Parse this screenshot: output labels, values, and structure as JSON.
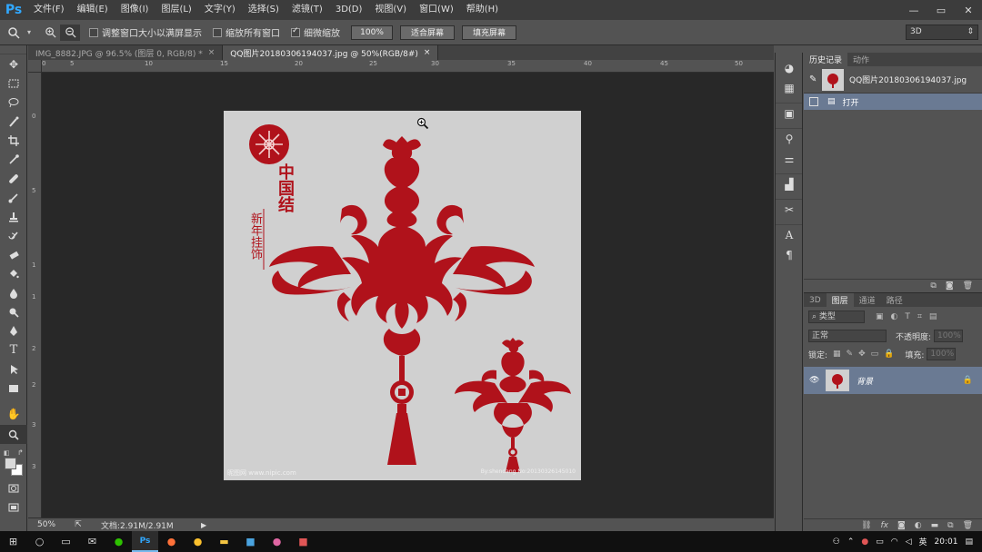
{
  "app": {
    "logo": "Ps"
  },
  "menu": [
    "文件(F)",
    "编辑(E)",
    "图像(I)",
    "图层(L)",
    "文字(Y)",
    "选择(S)",
    "滤镜(T)",
    "3D(D)",
    "视图(V)",
    "窗口(W)",
    "帮助(H)"
  ],
  "window_controls": {
    "minimize": "—",
    "restore": "▭",
    "close": "✕"
  },
  "options": {
    "resize_windows_label": "调整窗口大小以满屏显示",
    "zoom_all_label": "缩放所有窗口",
    "scrubby_zoom_label": "细微缩放",
    "zoom_100_button": "100%",
    "fit_screen_button": "适合屏幕",
    "fill_screen_button": "填充屏幕",
    "workspace": "3D"
  },
  "doc_tabs": [
    {
      "label": "IMG_8882.JPG @ 96.5% (图层 0, RGB/8) *",
      "close": "×"
    },
    {
      "label": "QQ图片20180306194037.jpg @ 50%(RGB/8#)",
      "close": "×"
    }
  ],
  "ruler_top": [
    "0",
    "5",
    "10",
    "15",
    "20",
    "25",
    "30",
    "35",
    "40",
    "45",
    "50"
  ],
  "ruler_left": [
    "0",
    "5",
    "1",
    "1",
    "2",
    "2",
    "3",
    "3"
  ],
  "image": {
    "title_main": "中国结",
    "title_sub": "新年挂饰",
    "watermark_left": "昵图网 www.nipic.com",
    "watermark_right": "By:shendang No:20130326145010"
  },
  "status": {
    "zoom": "50%",
    "doc_info": "文档:2.91M/2.91M"
  },
  "history": {
    "tabs": [
      "历史记录",
      "动作"
    ],
    "snapshot_name": "QQ图片20180306194037.jpg",
    "states": [
      "打开"
    ]
  },
  "layers": {
    "tabs": [
      "3D",
      "图层",
      "通道",
      "路径"
    ],
    "filter_kind": "类型",
    "blend_mode": "正常",
    "opacity_label": "不透明度:",
    "opacity_value": "100%",
    "lock_label": "锁定:",
    "fill_label": "填充:",
    "fill_value": "100%",
    "items": [
      {
        "name": "背景"
      }
    ]
  },
  "taskbar": {
    "time": "20:01",
    "ime": "英"
  }
}
